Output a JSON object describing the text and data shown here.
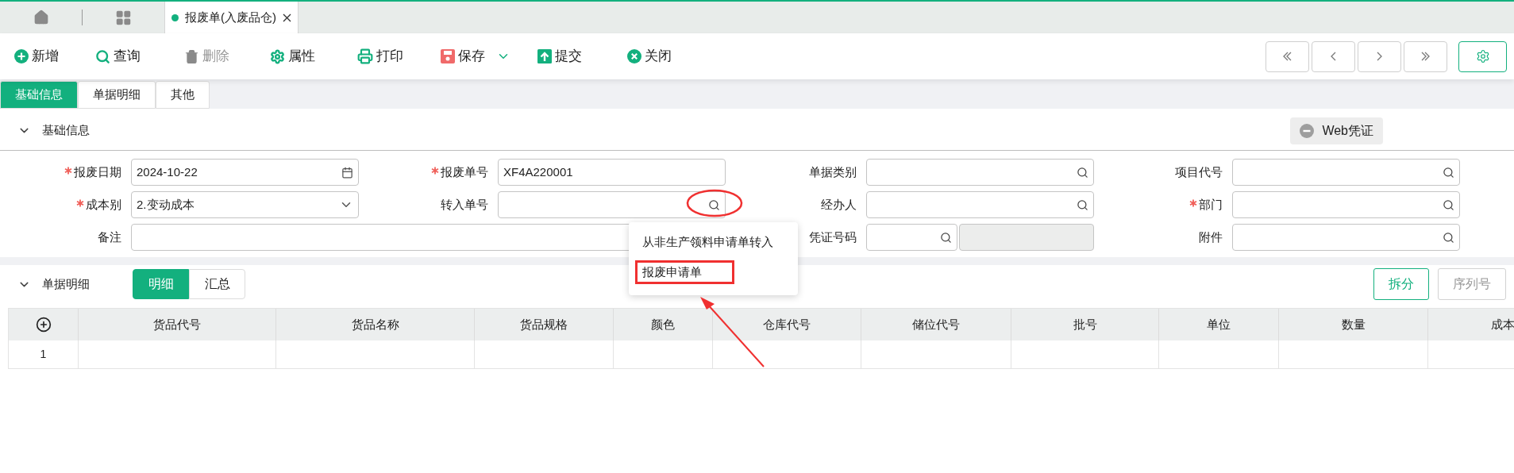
{
  "document_tabs": [
    {
      "label": "报废单(入废品仓)",
      "selected": true
    }
  ],
  "toolbar": [
    {
      "label": "新增",
      "disabled": false,
      "dropdown": false
    },
    {
      "label": "查询",
      "disabled": false,
      "dropdown": false
    },
    {
      "label": "删除",
      "disabled": true,
      "dropdown": false
    },
    {
      "label": "属性",
      "disabled": false,
      "dropdown": false
    },
    {
      "label": "打印",
      "disabled": false,
      "dropdown": false
    },
    {
      "label": "保存",
      "disabled": false,
      "dropdown": true
    },
    {
      "label": "提交",
      "disabled": false,
      "dropdown": false
    },
    {
      "label": "关闭",
      "disabled": false,
      "dropdown": false
    }
  ],
  "form_tabs": [
    {
      "label": "基础信息",
      "selected": true
    },
    {
      "label": "单据明细",
      "selected": false
    },
    {
      "label": "其他",
      "selected": false
    }
  ],
  "basic_section": {
    "title": "基础信息",
    "expanded": true,
    "voucher_button": "Web凭证"
  },
  "fields": [
    {
      "label": "报废日期",
      "required": true,
      "kind": "date",
      "value": "2024-10-22"
    },
    {
      "label": "报废单号",
      "required": true,
      "kind": "text",
      "value": "XF4A220001"
    },
    {
      "label": "单据类别",
      "required": false,
      "kind": "lookup"
    },
    {
      "label": "项目代号",
      "required": false,
      "kind": "lookup"
    },
    {
      "label": "成本别",
      "required": true,
      "kind": "select",
      "value": "2.变动成本"
    },
    {
      "label": "转入单号",
      "required": false,
      "kind": "lookup"
    },
    {
      "label": "经办人",
      "required": false,
      "kind": "lookup"
    },
    {
      "label": "部门",
      "required": true,
      "kind": "lookup"
    },
    {
      "label": "备注",
      "required": false,
      "kind": "wide"
    },
    {
      "label": "凭证号码",
      "required": false,
      "kind": "lookup_pair"
    },
    {
      "label": "附件",
      "required": false,
      "kind": "lookup"
    }
  ],
  "lookup_menu": {
    "items": [
      {
        "label": "从非生产领料申请单转入",
        "highlighted": false
      },
      {
        "label": "报废申请单",
        "highlighted": true
      }
    ]
  },
  "detail_section": {
    "title": "单据明细",
    "expanded": true,
    "view_toggle": [
      {
        "label": "明细",
        "selected": true
      },
      {
        "label": "汇总",
        "selected": false
      }
    ],
    "buttons": [
      {
        "label": "拆分",
        "disabled": false
      },
      {
        "label": "序列号",
        "disabled": true
      }
    ]
  },
  "table": {
    "columns": [
      "货品代号",
      "货品名称",
      "货品规格",
      "颜色",
      "仓库代号",
      "储位代号",
      "批号",
      "单位",
      "数量",
      "成本"
    ],
    "rows": [
      {
        "number": "1"
      }
    ]
  }
}
